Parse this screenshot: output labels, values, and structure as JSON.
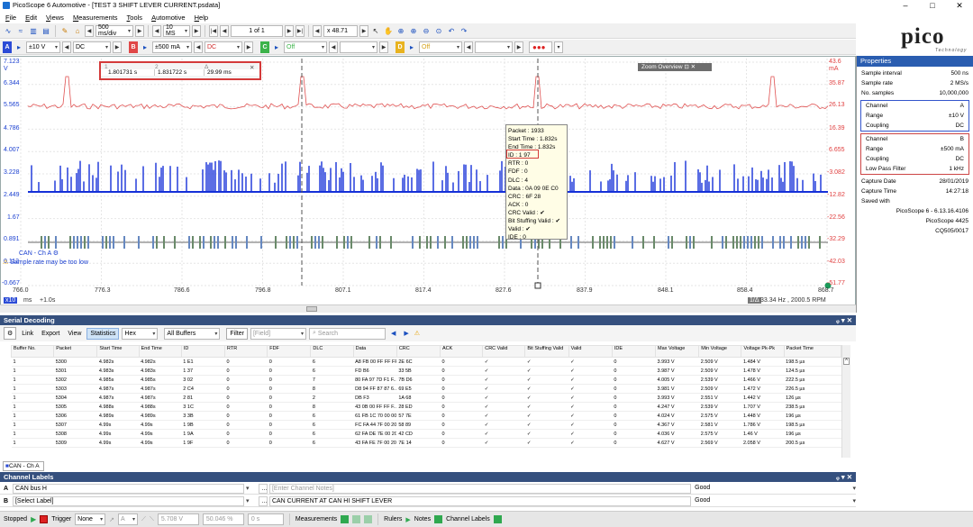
{
  "window": {
    "title": "PicoScope 6 Automotive - [TEST 3 SHIFT LEVER CURRENT.psdata]"
  },
  "menu": [
    "File",
    "Edit",
    "Views",
    "Measurements",
    "Tools",
    "Automotive",
    "Help"
  ],
  "toolbar1": {
    "timebase": "500 ms/div",
    "samples": "10 MS",
    "page": "1 of 1",
    "zoom": "x 48.71"
  },
  "toolbar2": {
    "chA": {
      "tag": "A",
      "range": "±10 V",
      "coupling": "DC",
      "color": "#2b4bd6"
    },
    "chB": {
      "tag": "B",
      "range": "±500 mA",
      "coupling": "DC",
      "color": "#e04848"
    },
    "chC": {
      "tag": "C",
      "range": "Off",
      "color": "#3cb34a"
    },
    "chD": {
      "tag": "D",
      "range": "Off",
      "color": "#e8b320"
    }
  },
  "logo": {
    "text": "pico",
    "sub": "Technology"
  },
  "scope": {
    "yleft": [
      "7.123",
      "V",
      "6.344",
      "5.565",
      "4.786",
      "4.007",
      "3.228",
      "2.449",
      "1.67",
      "0.891",
      "0.112",
      "-0.667"
    ],
    "yright": [
      "43.6",
      "mA",
      "35.87",
      "26.13",
      "16.39",
      "6.655",
      "-3.082",
      "-12.82",
      "-22.56",
      "-32.29",
      "-42.03",
      "-51.77"
    ],
    "xticks": [
      "766.0",
      "776.3",
      "786.6",
      "796.8",
      "807.1",
      "817.4",
      "827.6",
      "837.9",
      "848.1",
      "858.4",
      "868.7"
    ],
    "xunit": "ms",
    "xmult": "+1.0s",
    "xleft": "x10",
    "rulers": {
      "t1": "1.801731 s",
      "t2": "1.831722 s",
      "dt": "29.99 ms"
    },
    "zoom_overview": "Zoom Overview",
    "can_label": "CAN - Ch A",
    "warning": "Sample rate may be too low",
    "freq_readout": "33.34 Hz , 2000.5 RPM",
    "freq_tag": "1/Δ"
  },
  "tooltip": [
    "Packet : 1933",
    "Start Time : 1.832s",
    "End Time : 1.832s",
    "ID : 1 97",
    "RTR : 0",
    "FDF : 0",
    "DLC : 4",
    "Data : 0A 09 0E C0",
    "CRC : 6F 28",
    "ACK : 0",
    "CRC Valid : ✔",
    "Bit Stuffing Valid : ✔",
    "Valid : ✔",
    "IDE : 0"
  ],
  "properties": {
    "title": "Properties",
    "general": [
      [
        "Sample interval",
        "500 ns"
      ],
      [
        "Sample rate",
        "2 MS/s"
      ],
      [
        "No. samples",
        "10,000,000"
      ]
    ],
    "chA": [
      [
        "Channel",
        "A"
      ],
      [
        "Range",
        "±10 V"
      ],
      [
        "Coupling",
        "DC"
      ]
    ],
    "chB": [
      [
        "Channel",
        "B"
      ],
      [
        "Range",
        "±500 mA"
      ],
      [
        "Coupling",
        "DC"
      ],
      [
        "Low Pass Filter",
        "1 kHz"
      ]
    ],
    "meta": [
      [
        "Capture Date",
        "28/01/2019"
      ],
      [
        "Capture Time",
        "14:27:18"
      ],
      [
        "Saved with",
        ""
      ]
    ],
    "saved": [
      "PicoScope 6 - 6.13.16.4106",
      "PicoScope 4425",
      "CQ505/0017"
    ]
  },
  "serial": {
    "title": "Serial Decoding",
    "toolbar": [
      "Link",
      "Export",
      "View",
      "Statistics",
      "Hex",
      "All Buffers",
      "Filter",
      "[Field]",
      "Search"
    ],
    "columns": [
      "Buffer No.",
      "Packet",
      "Start Time",
      "End Time",
      "ID",
      "RTR",
      "FDF",
      "DLC",
      "Data",
      "CRC",
      "ACK",
      "CRC Valid",
      "Bit Stuffing Valid",
      "Valid",
      "IDE",
      "Max Voltage",
      "Min Voltage",
      "Voltage Pk-Pk",
      "Packet Time"
    ],
    "rows": [
      [
        "1",
        "5300",
        "4.982s",
        "4.982s",
        "1 E1",
        "0",
        "0",
        "6",
        "A8 FB 00 FF FF FF",
        "2E 6C",
        "0",
        "✓",
        "✓",
        "✓",
        "0",
        "3.993 V",
        "2.509 V",
        "1.484 V",
        "198.5 µs"
      ],
      [
        "1",
        "5301",
        "4.983s",
        "4.983s",
        "1 37",
        "0",
        "0",
        "6",
        "FD B6",
        "33 5B",
        "0",
        "✓",
        "✓",
        "✓",
        "0",
        "3.987 V",
        "2.509 V",
        "1.478 V",
        "124.5 µs"
      ],
      [
        "1",
        "5302",
        "4.985s",
        "4.985s",
        "3 02",
        "0",
        "0",
        "7",
        "80 FA 97 7D F1 F...",
        "7B D6",
        "0",
        "✓",
        "✓",
        "✓",
        "0",
        "4.005 V",
        "2.539 V",
        "1.466 V",
        "222.5 µs"
      ],
      [
        "1",
        "5303",
        "4.987s",
        "4.987s",
        "2 C4",
        "0",
        "0",
        "8",
        "D8 94 FF 87 87 6...",
        "69 E5",
        "0",
        "✓",
        "✓",
        "✓",
        "0",
        "3.981 V",
        "2.509 V",
        "1.472 V",
        "226.5 µs"
      ],
      [
        "1",
        "5304",
        "4.987s",
        "4.987s",
        "2 81",
        "0",
        "0",
        "2",
        "DB F3",
        "1A 68",
        "0",
        "✓",
        "✓",
        "✓",
        "0",
        "3.993 V",
        "2.551 V",
        "1.442 V",
        "126 µs"
      ],
      [
        "1",
        "5305",
        "4.988s",
        "4.988s",
        "3 1C",
        "0",
        "0",
        "8",
        "43 0B 00 FF FF F...",
        "28 ED",
        "0",
        "✓",
        "✓",
        "✓",
        "0",
        "4.247 V",
        "2.539 V",
        "1.707 V",
        "238.5 µs"
      ],
      [
        "1",
        "5306",
        "4.989s",
        "4.989s",
        "3 3B",
        "0",
        "0",
        "6",
        "61 FB 1C 70 00 00",
        "57 7E",
        "0",
        "✓",
        "✓",
        "✓",
        "0",
        "4.024 V",
        "2.575 V",
        "1.448 V",
        "196 µs"
      ],
      [
        "1",
        "5307",
        "4.99s",
        "4.99s",
        "1 9B",
        "0",
        "0",
        "6",
        "FC FA 44 7F 00 20",
        "58 89",
        "0",
        "✓",
        "✓",
        "✓",
        "0",
        "4.367 V",
        "2.581 V",
        "1.786 V",
        "198.5 µs"
      ],
      [
        "1",
        "5308",
        "4.99s",
        "4.99s",
        "1 9A",
        "0",
        "0",
        "6",
        "62 FA DE 7E 00 20",
        "42 CD",
        "0",
        "✓",
        "✓",
        "✓",
        "0",
        "4.036 V",
        "2.575 V",
        "1.46 V",
        "196 µs"
      ],
      [
        "1",
        "5309",
        "4.99s",
        "4.99s",
        "1 9F",
        "0",
        "0",
        "6",
        "43 FA FE 7F 00 20",
        "7E 14",
        "0",
        "✓",
        "✓",
        "✓",
        "0",
        "4.627 V",
        "2.569 V",
        "2.058 V",
        "200.5 µs"
      ]
    ],
    "tab": "CAN - Ch A"
  },
  "channel_labels": {
    "title": "Channel Labels",
    "rows": [
      {
        "ch": "A",
        "label": "CAN bus H",
        "notes": "[Enter Channel Notes]",
        "status": "Good"
      },
      {
        "ch": "B",
        "label": "[Select Label]",
        "notes": "CAN CURRENT AT CAN HI SHIFT LEVER",
        "status": "Good"
      }
    ]
  },
  "statusbar": {
    "state": "Stopped",
    "trigger": "Trigger",
    "trig_mode": "None",
    "trig_ch": "A",
    "trig_level": "5.708 V",
    "trig_pct": "50.046 %",
    "trig_delay": "0 s",
    "items": [
      "Measurements",
      "Rulers",
      "Notes",
      "Channel Labels"
    ]
  }
}
